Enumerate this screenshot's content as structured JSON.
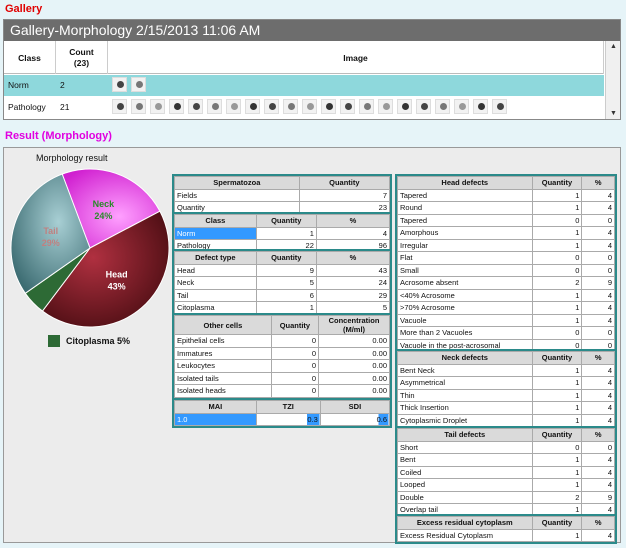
{
  "gallery": {
    "title": "Gallery",
    "header": "Gallery-Morphology 2/15/2013 11:06 AM",
    "columns": {
      "class": "Class",
      "count": "Count\n(23)",
      "image": "Image"
    },
    "rows": [
      {
        "class": "Norm",
        "count": "2",
        "thumbs": 2
      },
      {
        "class": "Pathology",
        "count": "21",
        "thumbs": 21
      }
    ]
  },
  "result": {
    "title": "Result (Morphology)",
    "chart_title": "Morphology result",
    "legend_citoplasma": "Citoplasma 5%"
  },
  "chart_data": {
    "type": "pie",
    "title": "Morphology result",
    "slices": [
      {
        "label": "Head",
        "percent": 43,
        "color": "#7a1a22"
      },
      {
        "label": "Neck",
        "percent": 24,
        "color": "#ee44ee"
      },
      {
        "label": "Tail",
        "percent": 29,
        "color": "#5a8c92"
      },
      {
        "label": "Citoplasma",
        "percent": 5,
        "color": "#2d6a35"
      }
    ],
    "labels": {
      "head": "Head\n43%",
      "neck": "Neck\n24%",
      "tail": "Tail\n29%"
    }
  },
  "spermatozoa": {
    "h1": "Spermatozoa",
    "h2": "Quantity",
    "rows": [
      [
        "Fields",
        "7"
      ],
      [
        "Quantity",
        "23"
      ]
    ]
  },
  "class_tbl": {
    "h1": "Class",
    "h2": "Quantity",
    "h3": "%",
    "rows": [
      [
        "Norm",
        "1",
        "4"
      ],
      [
        "Pathology",
        "22",
        "96"
      ]
    ]
  },
  "defect_type": {
    "h1": "Defect type",
    "h2": "Quantity",
    "h3": "%",
    "rows": [
      [
        "Head",
        "9",
        "43"
      ],
      [
        "Neck",
        "5",
        "24"
      ],
      [
        "Tail",
        "6",
        "29"
      ],
      [
        "Citoplasma",
        "1",
        "5"
      ]
    ]
  },
  "other_cells": {
    "h1": "Other cells",
    "h2": "Quantity",
    "h3": "Concentration (M/ml)",
    "rows": [
      [
        "Epithelial cells",
        "0",
        "0.00"
      ],
      [
        "Immatures",
        "0",
        "0.00"
      ],
      [
        "Leukocytes",
        "0",
        "0.00"
      ],
      [
        "Isolated tails",
        "0",
        "0.00"
      ],
      [
        "Isolated heads",
        "0",
        "0.00"
      ]
    ]
  },
  "indices": {
    "h1": "MAI",
    "h2": "TZI",
    "h3": "SDI",
    "v1": "1.0",
    "v2": "0.3",
    "v3": "0.6"
  },
  "head_defects": {
    "h1": "Head defects",
    "h2": "Quantity",
    "h3": "%",
    "rows": [
      [
        "Tapered",
        "1",
        "4"
      ],
      [
        "Round",
        "1",
        "4"
      ],
      [
        "Tapered",
        "0",
        "0"
      ],
      [
        "Amorphous",
        "1",
        "4"
      ],
      [
        "Irregular",
        "1",
        "4"
      ],
      [
        "Flat",
        "0",
        "0"
      ],
      [
        "Small",
        "0",
        "0"
      ],
      [
        "Acrosome absent",
        "2",
        "9"
      ],
      [
        "<40% Acrosome",
        "1",
        "4"
      ],
      [
        ">70% Acrosome",
        "1",
        "4"
      ],
      [
        "Vacuole",
        "1",
        "4"
      ],
      [
        "More than 2 Vacuoles",
        "0",
        "0"
      ],
      [
        "Vacuole in the post-acrosomal",
        "0",
        "0"
      ]
    ]
  },
  "neck_defects": {
    "h1": "Neck defects",
    "h2": "Quantity",
    "h3": "%",
    "rows": [
      [
        "Bent Neck",
        "1",
        "4"
      ],
      [
        "Asymmetrical",
        "1",
        "4"
      ],
      [
        "Thin",
        "1",
        "4"
      ],
      [
        "Thick Insertion",
        "1",
        "4"
      ],
      [
        "Cytoplasmic Droplet",
        "1",
        "4"
      ]
    ]
  },
  "tail_defects": {
    "h1": "Tail defects",
    "h2": "Quantity",
    "h3": "%",
    "rows": [
      [
        "Short",
        "0",
        "0"
      ],
      [
        "Bent",
        "1",
        "4"
      ],
      [
        "Coiled",
        "1",
        "4"
      ],
      [
        "Looped",
        "1",
        "4"
      ],
      [
        "Double",
        "2",
        "9"
      ],
      [
        "Overlap tail",
        "1",
        "4"
      ]
    ]
  },
  "excess": {
    "h1": "Excess residual cytoplasm",
    "h2": "Quantity",
    "h3": "%",
    "rows": [
      [
        "Excess Residual Cytoplasm",
        "1",
        "4"
      ]
    ]
  }
}
